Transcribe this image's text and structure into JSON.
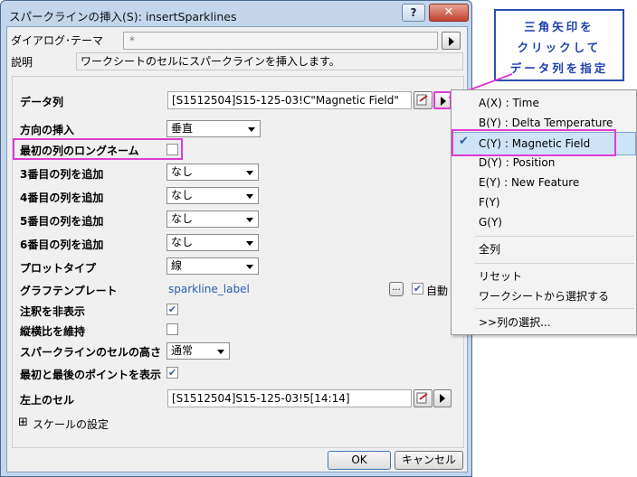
{
  "dialog": {
    "title": "スパークラインの挿入(S): insertSparklines",
    "help_label": "?",
    "close_label": "✕",
    "theme_label": "ダイアログ･テーマ",
    "theme_value": "*",
    "desc_label": "説明",
    "desc_text": "ワークシートのセルにスパークラインを挿入します。",
    "fields": {
      "data_col_label": "データ列",
      "data_col_value": "[S1512504]S15-125-03!C\"Magnetic Field\"",
      "direction_label": "方向の挿入",
      "direction_value": "垂直",
      "longname_label": "最初の列のロングネーム",
      "col3_label": "3番目の列を追加",
      "col3_value": "なし",
      "col4_label": "4番目の列を追加",
      "col4_value": "なし",
      "col5_label": "5番目の列を追加",
      "col5_value": "なし",
      "col6_label": "6番目の列を追加",
      "col6_value": "なし",
      "plottype_label": "プロットタイプ",
      "plottype_value": "線",
      "template_label": "グラフテンプレート",
      "template_value": "sparkline_label",
      "template_browse": "...",
      "auto_label": "自動",
      "hide_annot_label": "注釈を非表示",
      "aspect_label": "縦横比を維持",
      "height_label": "スパークラインのセルの高さ",
      "height_value": "通常",
      "first_last_label": "最初と最後のポイントを表示",
      "topleft_label": "左上のセル",
      "topleft_value": "[S1512504]S15-125-03!5[14:14]",
      "scale_label": "スケールの設定",
      "scale_expander": "⊞"
    },
    "checkboxes": {
      "longname": false,
      "auto": true,
      "hide_annot": true,
      "aspect": false,
      "first_last": true
    },
    "ok_label": "OK",
    "cancel_label": "キャンセル"
  },
  "menu": {
    "items": [
      {
        "label": "A(X) : Time"
      },
      {
        "label": "B(Y) : Delta Temperature"
      },
      {
        "label": "C(Y) : Magnetic Field",
        "checked": true
      },
      {
        "label": "D(Y) : Position"
      },
      {
        "label": "E(Y) : New Feature"
      },
      {
        "label": "F(Y)"
      },
      {
        "label": "G(Y)"
      },
      {
        "label": "全列"
      },
      {
        "label": "リセット"
      },
      {
        "label": "ワークシートから選択する"
      },
      {
        "label": ">>列の選択..."
      }
    ],
    "check_mark": "✔"
  },
  "callout": {
    "lines": [
      "三角矢印を",
      "クリックして",
      "データ列を指定"
    ]
  },
  "colors": {
    "highlight": "#e03cd2",
    "callout_border": "#2c4fb0",
    "callout_text": "#1b3fae",
    "selected_bg": "#cfe3f8"
  }
}
